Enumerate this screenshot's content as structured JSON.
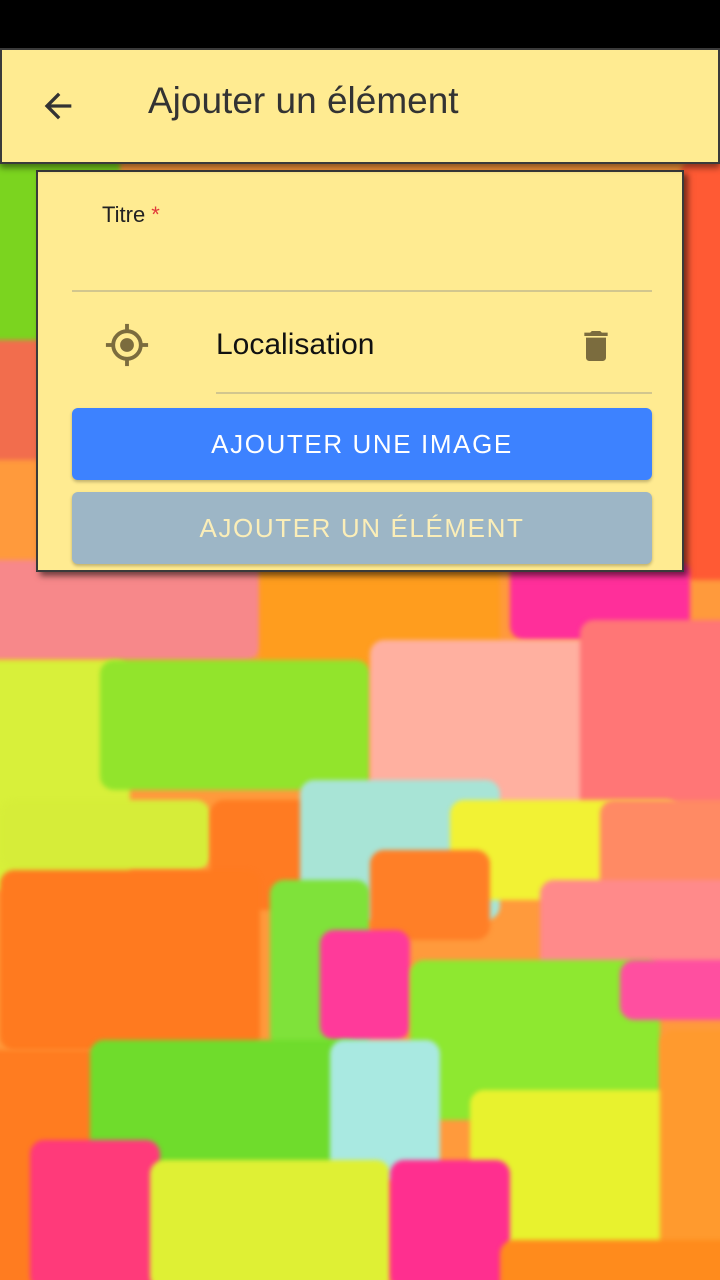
{
  "app_bar": {
    "title": "Ajouter un élément",
    "back_icon": "arrow-back-icon"
  },
  "form": {
    "title_field": {
      "label": "Titre",
      "required_mark": "*",
      "value": ""
    },
    "location": {
      "icon": "gps-target-icon",
      "label": "Localisation",
      "delete_icon": "trash-icon"
    },
    "buttons": {
      "add_image": "AJOUTER UNE IMAGE",
      "add_item": "AJOUTER UN ÉLÉMENT"
    }
  },
  "colors": {
    "card_bg": "#ffeb91",
    "primary": "#3d82ff",
    "disabled": "#9db6c6",
    "required": "#e03a3a"
  }
}
